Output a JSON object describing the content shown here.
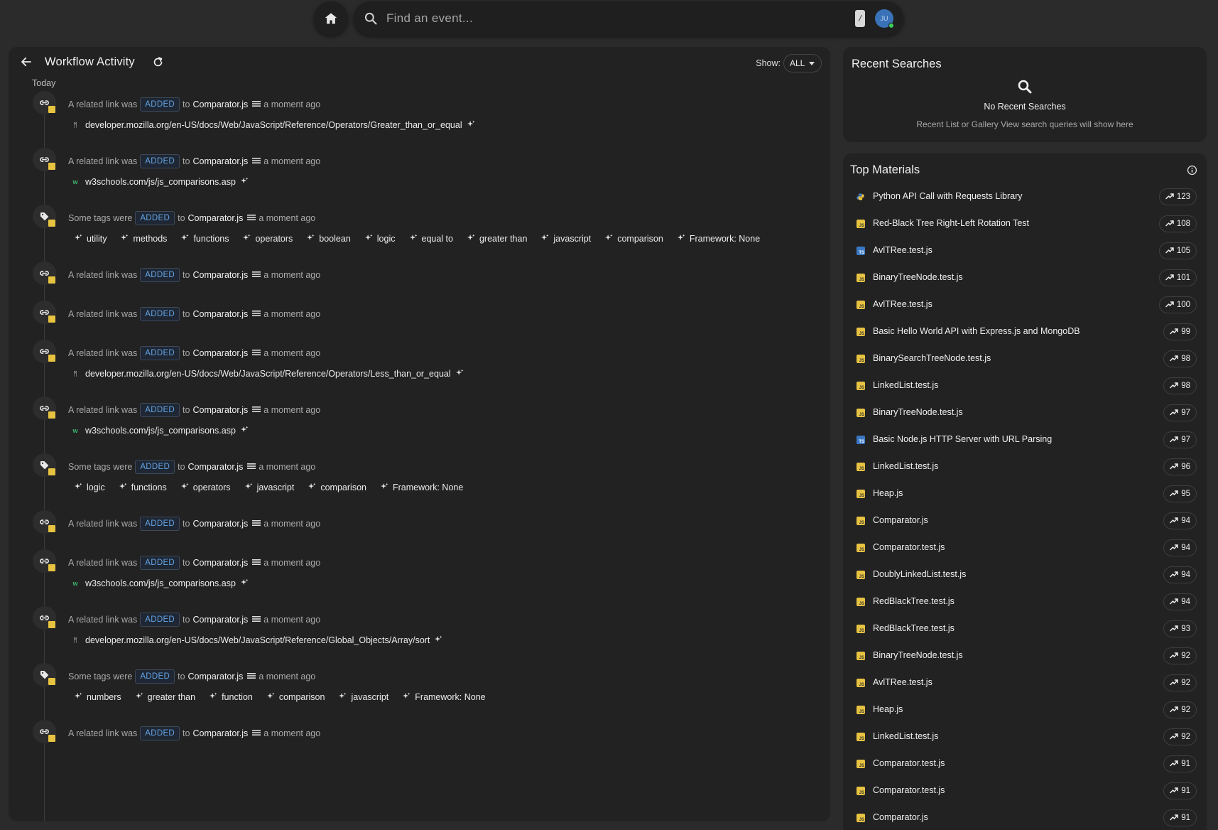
{
  "search": {
    "placeholder": "Find an event...",
    "shortcut": "/"
  },
  "user": {
    "initials": "JU"
  },
  "workflow": {
    "title": "Workflow Activity",
    "show_label": "Show:",
    "show_value": "ALL",
    "group_label": "Today"
  },
  "events": [
    {
      "kind": "link",
      "prefix": "A related link was",
      "action": "ADDED",
      "to": "to",
      "target": "Comparator.js",
      "time": "a moment ago",
      "links": [
        {
          "favicon": "M",
          "url": "developer.mozilla.org/en-US/docs/Web/JavaScript/Reference/Operators/Greater_than_or_equal"
        }
      ]
    },
    {
      "kind": "link",
      "prefix": "A related link was",
      "action": "ADDED",
      "to": "to",
      "target": "Comparator.js",
      "time": "a moment ago",
      "links": [
        {
          "favicon": "w3",
          "url": "w3schools.com/js/js_comparisons.asp"
        }
      ]
    },
    {
      "kind": "tags",
      "prefix": "Some tags were",
      "action": "ADDED",
      "to": "to",
      "target": "Comparator.js",
      "time": "a moment ago",
      "tags": [
        "utility",
        "methods",
        "functions",
        "operators",
        "boolean",
        "logic",
        "equal to",
        "greater than",
        "javascript",
        "comparison",
        "Framework: None"
      ]
    },
    {
      "kind": "link",
      "prefix": "A related link was",
      "action": "ADDED",
      "to": "to",
      "target": "Comparator.js",
      "time": "a moment ago",
      "links": []
    },
    {
      "kind": "link",
      "prefix": "A related link was",
      "action": "ADDED",
      "to": "to",
      "target": "Comparator.js",
      "time": "a moment ago",
      "links": []
    },
    {
      "kind": "link",
      "prefix": "A related link was",
      "action": "ADDED",
      "to": "to",
      "target": "Comparator.js",
      "time": "a moment ago",
      "links": [
        {
          "favicon": "M",
          "url": "developer.mozilla.org/en-US/docs/Web/JavaScript/Reference/Operators/Less_than_or_equal"
        }
      ]
    },
    {
      "kind": "link",
      "prefix": "A related link was",
      "action": "ADDED",
      "to": "to",
      "target": "Comparator.js",
      "time": "a moment ago",
      "links": [
        {
          "favicon": "w3",
          "url": "w3schools.com/js/js_comparisons.asp"
        }
      ]
    },
    {
      "kind": "tags",
      "prefix": "Some tags were",
      "action": "ADDED",
      "to": "to",
      "target": "Comparator.js",
      "time": "a moment ago",
      "tags": [
        "logic",
        "functions",
        "operators",
        "javascript",
        "comparison",
        "Framework: None"
      ]
    },
    {
      "kind": "link",
      "prefix": "A related link was",
      "action": "ADDED",
      "to": "to",
      "target": "Comparator.js",
      "time": "a moment ago",
      "links": []
    },
    {
      "kind": "link",
      "prefix": "A related link was",
      "action": "ADDED",
      "to": "to",
      "target": "Comparator.js",
      "time": "a moment ago",
      "links": [
        {
          "favicon": "w3",
          "url": "w3schools.com/js/js_comparisons.asp"
        }
      ]
    },
    {
      "kind": "link",
      "prefix": "A related link was",
      "action": "ADDED",
      "to": "to",
      "target": "Comparator.js",
      "time": "a moment ago",
      "links": [
        {
          "favicon": "M",
          "url": "developer.mozilla.org/en-US/docs/Web/JavaScript/Reference/Global_Objects/Array/sort"
        }
      ]
    },
    {
      "kind": "tags",
      "prefix": "Some tags were",
      "action": "ADDED",
      "to": "to",
      "target": "Comparator.js",
      "time": "a moment ago",
      "tags": [
        "numbers",
        "greater than",
        "function",
        "comparison",
        "javascript",
        "Framework: None"
      ]
    },
    {
      "kind": "link",
      "prefix": "A related link was",
      "action": "ADDED",
      "to": "to",
      "target": "Comparator.js",
      "time": "a moment ago",
      "links": []
    }
  ],
  "recent_searches": {
    "title": "Recent Searches",
    "empty_title": "No Recent Searches",
    "empty_hint": "Recent List or Gallery View search queries will show here"
  },
  "top_materials": {
    "title": "Top Materials",
    "items": [
      {
        "type": "py",
        "name": "Python API Call with Requests Library",
        "count": "123"
      },
      {
        "type": "js",
        "name": "Red-Black Tree Right-Left Rotation Test",
        "count": "108"
      },
      {
        "type": "ts",
        "name": "AvlTRee.test.js",
        "count": "105"
      },
      {
        "type": "js",
        "name": "BinaryTreeNode.test.js",
        "count": "101"
      },
      {
        "type": "js",
        "name": "AvlTRee.test.js",
        "count": "100"
      },
      {
        "type": "js",
        "name": "Basic Hello World API with Express.js and MongoDB",
        "count": "99"
      },
      {
        "type": "js",
        "name": "BinarySearchTreeNode.test.js",
        "count": "98"
      },
      {
        "type": "js",
        "name": "LinkedList.test.js",
        "count": "98"
      },
      {
        "type": "js",
        "name": "BinaryTreeNode.test.js",
        "count": "97"
      },
      {
        "type": "ts",
        "name": "Basic Node.js HTTP Server with URL Parsing",
        "count": "97"
      },
      {
        "type": "js",
        "name": "LinkedList.test.js",
        "count": "96"
      },
      {
        "type": "js",
        "name": "Heap.js",
        "count": "95"
      },
      {
        "type": "js",
        "name": "Comparator.js",
        "count": "94"
      },
      {
        "type": "js",
        "name": "Comparator.test.js",
        "count": "94"
      },
      {
        "type": "js",
        "name": "DoublyLinkedList.test.js",
        "count": "94"
      },
      {
        "type": "js",
        "name": "RedBlackTree.test.js",
        "count": "94"
      },
      {
        "type": "js",
        "name": "RedBlackTree.test.js",
        "count": "93"
      },
      {
        "type": "js",
        "name": "BinaryTreeNode.test.js",
        "count": "92"
      },
      {
        "type": "js",
        "name": "AvlTRee.test.js",
        "count": "92"
      },
      {
        "type": "js",
        "name": "Heap.js",
        "count": "92"
      },
      {
        "type": "js",
        "name": "LinkedList.test.js",
        "count": "92"
      },
      {
        "type": "js",
        "name": "Comparator.test.js",
        "count": "91"
      },
      {
        "type": "js",
        "name": "Comparator.test.js",
        "count": "91"
      },
      {
        "type": "js",
        "name": "Comparator.js",
        "count": "91"
      }
    ]
  }
}
